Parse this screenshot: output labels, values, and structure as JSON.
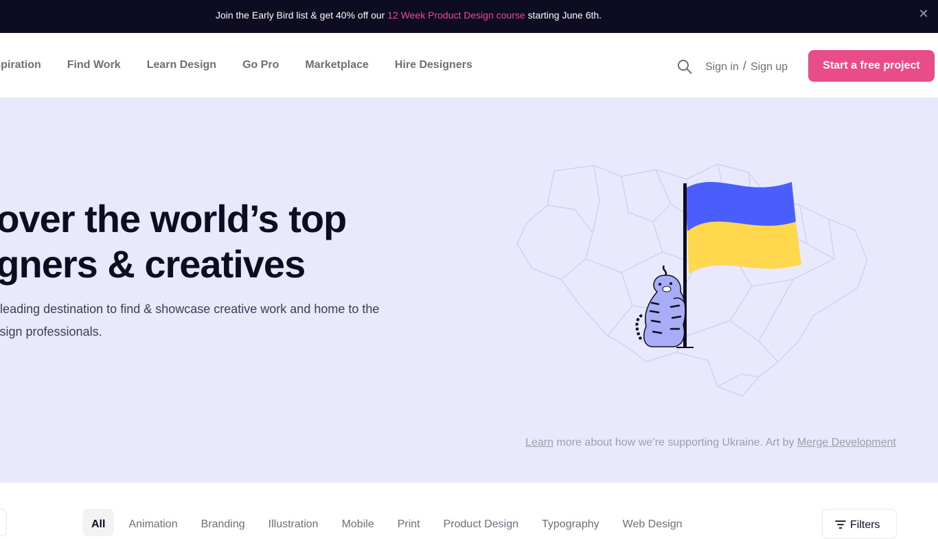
{
  "announcement": {
    "prefix": "Join the Early Bird list & get 40% off our ",
    "link": "12 Week Product Design course",
    "suffix": " starting June 6th.",
    "close_glyph": "✕"
  },
  "nav": {
    "links": [
      "Inspiration",
      "Find Work",
      "Learn Design",
      "Go Pro",
      "Marketplace",
      "Hire Designers"
    ],
    "sign_in": "Sign in",
    "separator": "/",
    "sign_up": "Sign up",
    "cta": "Start a free project"
  },
  "hero": {
    "title_line1": "Discover the world’s top",
    "title_line2": "Designers & creatives",
    "subtitle": "Dribbble is the leading destination to find & showcase creative work and home to the world's best design professionals.",
    "credit": {
      "learn": "Learn",
      "middle": " more about how we’re supporting Ukraine. Art by ",
      "artist": "Merge Development"
    }
  },
  "categories": {
    "items": [
      "All",
      "Animation",
      "Branding",
      "Illustration",
      "Mobile",
      "Print",
      "Product Design",
      "Typography",
      "Web Design"
    ],
    "active": "All",
    "filters_label": "Filters"
  },
  "colors": {
    "brand_pink": "#ea4c89",
    "dark": "#0d0c22",
    "hero_bg": "#e8e9fc",
    "flag_blue": "#4a5efb",
    "flag_yellow": "#ffd84d"
  }
}
